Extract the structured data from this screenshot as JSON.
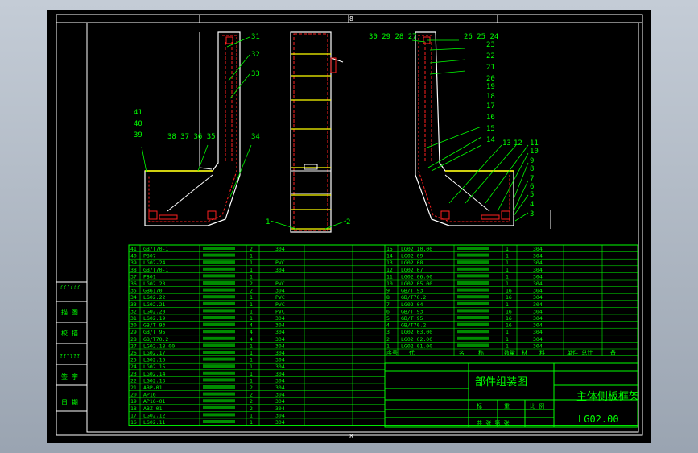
{
  "colors": {
    "background": "#000000",
    "frame": "#ffffff",
    "table_lines": "#00ff00",
    "text": "#00ff00",
    "drawing": "#ffffff",
    "accent_red": "#ff2020",
    "accent_yellow": "#ffff00"
  },
  "grid_marks": [
    "8",
    "8"
  ],
  "callouts_top": [
    "31",
    "32",
    "33"
  ],
  "callouts_left": [
    "41",
    "40",
    "39"
  ],
  "callouts_mid_left": "38 37 36 35",
  "callout_34": "34",
  "callouts_bottom": [
    "1",
    "2"
  ],
  "callouts_right_top_a": "30 29 28 27",
  "callouts_right_top_b": "26 25 24",
  "callouts_right_col": [
    "23",
    "22",
    "21",
    "20",
    "19",
    "18",
    "17",
    "16",
    "15",
    "14"
  ],
  "callouts_right_low": [
    "13",
    "12",
    "11",
    "10",
    "9",
    "8",
    "7",
    "6",
    "5",
    "4",
    "3"
  ],
  "side_labels": [
    "??????",
    "描 图",
    "校 描",
    "??????",
    "签 字",
    "日 期"
  ],
  "header_row": [
    "序号",
    "代",
    "名",
    "称",
    "数量",
    "材",
    "料",
    "单件 总计",
    "备"
  ],
  "parts_left": [
    {
      "no": "41",
      "code": "GB/T70-1",
      "qty": "2",
      "mat": "304"
    },
    {
      "no": "40",
      "code": "P807",
      "qty": "1",
      "mat": ""
    },
    {
      "no": "39",
      "code": "LG02-24",
      "qty": "1",
      "mat": "PVC"
    },
    {
      "no": "38",
      "code": "GB/T70-1",
      "qty": "1",
      "mat": "304"
    },
    {
      "no": "37",
      "code": "P801",
      "qty": "1",
      "mat": ""
    },
    {
      "no": "36",
      "code": "LG02.23",
      "qty": "2",
      "mat": "PVC"
    },
    {
      "no": "35",
      "code": "GB6170",
      "qty": "2",
      "mat": "304"
    },
    {
      "no": "34",
      "code": "LG02.22",
      "qty": "1",
      "mat": "PVC"
    },
    {
      "no": "33",
      "code": "LG02.21",
      "qty": "1",
      "mat": "PVC"
    },
    {
      "no": "32",
      "code": "LG02.20",
      "qty": "1",
      "mat": "PVC"
    },
    {
      "no": "31",
      "code": "LG02.19",
      "qty": "1",
      "mat": "304"
    },
    {
      "no": "30",
      "code": "GB/T 93",
      "qty": "4",
      "mat": "304"
    },
    {
      "no": "29",
      "code": "GB/T 95",
      "qty": "4",
      "mat": "304"
    },
    {
      "no": "28",
      "code": "GB/T70.2",
      "qty": "4",
      "mat": "304"
    },
    {
      "no": "27",
      "code": "LG02.18.00",
      "qty": "1",
      "mat": "304"
    },
    {
      "no": "26",
      "code": "LG02.17",
      "qty": "1",
      "mat": "304"
    },
    {
      "no": "25",
      "code": "LG02.16",
      "qty": "1",
      "mat": "304"
    },
    {
      "no": "24",
      "code": "LG02.15",
      "qty": "1",
      "mat": "304"
    },
    {
      "no": "23",
      "code": "LG02.14",
      "qty": "1",
      "mat": "304"
    },
    {
      "no": "22",
      "code": "LG02.13",
      "qty": "1",
      "mat": "304"
    },
    {
      "no": "21",
      "code": "ABP-01",
      "qty": "2",
      "mat": "304"
    },
    {
      "no": "20",
      "code": "AP16",
      "qty": "2",
      "mat": "304"
    },
    {
      "no": "19",
      "code": "AP16-01",
      "qty": "2",
      "mat": "304"
    },
    {
      "no": "18",
      "code": "ABZ-01",
      "qty": "2",
      "mat": "304"
    },
    {
      "no": "17",
      "code": "LG02.12",
      "qty": "1",
      "mat": "304"
    },
    {
      "no": "16",
      "code": "LG02.11",
      "qty": "1",
      "mat": "304"
    }
  ],
  "parts_right": [
    {
      "no": "15",
      "code": "LG02.10.00",
      "qty": "1",
      "mat": "304"
    },
    {
      "no": "14",
      "code": "LG02.09",
      "qty": "1",
      "mat": "304"
    },
    {
      "no": "13",
      "code": "LG02.08",
      "qty": "1",
      "mat": "304"
    },
    {
      "no": "12",
      "code": "LG02.07",
      "qty": "1",
      "mat": "304"
    },
    {
      "no": "11",
      "code": "LG02.06.00",
      "qty": "1",
      "mat": "304"
    },
    {
      "no": "10",
      "code": "LG02.05.00",
      "qty": "1",
      "mat": "304"
    },
    {
      "no": "9",
      "code": "GB/T 93",
      "qty": "16",
      "mat": "304"
    },
    {
      "no": "8",
      "code": "GB/T70.2",
      "qty": "16",
      "mat": "304"
    },
    {
      "no": "7",
      "code": "LG02.04",
      "qty": "1",
      "mat": "304"
    },
    {
      "no": "6",
      "code": "GB/T 93",
      "qty": "16",
      "mat": "304"
    },
    {
      "no": "5",
      "code": "GB/T 95",
      "qty": "16",
      "mat": "304"
    },
    {
      "no": "4",
      "code": "GB/T70.2",
      "qty": "16",
      "mat": "304"
    },
    {
      "no": "3",
      "code": "LG02.03.00",
      "qty": "1",
      "mat": "304"
    },
    {
      "no": "2",
      "code": "LG02.02.00",
      "qty": "1",
      "mat": "304"
    },
    {
      "no": "1",
      "code": "LG02.01.00",
      "qty": "1",
      "mat": "304"
    }
  ],
  "title_block": {
    "drawing_type": "部件组装图",
    "title": "主体侧板框架",
    "drawing_no": "LG02.00",
    "field_a": "标",
    "field_b": "重",
    "field_c": "比 例",
    "sheet": "共  张  第  张"
  }
}
